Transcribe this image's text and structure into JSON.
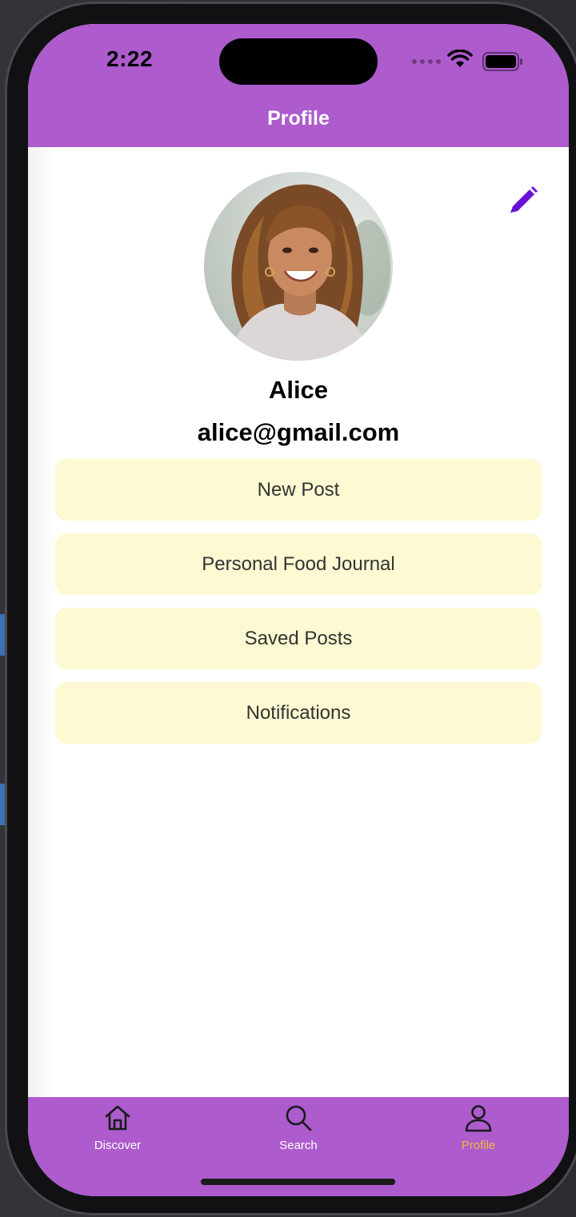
{
  "status_bar": {
    "time": "2:22"
  },
  "header": {
    "title": "Profile"
  },
  "profile": {
    "name": "Alice",
    "email": "alice@gmail.com",
    "edit_icon": "pencil-icon",
    "avatar": "profile-photo"
  },
  "menu": {
    "items": [
      {
        "label": "New Post"
      },
      {
        "label": "Personal Food Journal"
      },
      {
        "label": "Saved Posts"
      },
      {
        "label": "Notifications"
      }
    ]
  },
  "tabbar": {
    "tabs": [
      {
        "label": "Discover",
        "icon": "home-icon",
        "active": false
      },
      {
        "label": "Search",
        "icon": "search-icon",
        "active": false
      },
      {
        "label": "Profile",
        "icon": "person-icon",
        "active": true
      }
    ]
  },
  "colors": {
    "brand_purple": "#ad5bcd",
    "menu_button_bg": "#fdf9d2",
    "edit_icon": "#6a11d8",
    "active_tab": "#f5b73a"
  }
}
